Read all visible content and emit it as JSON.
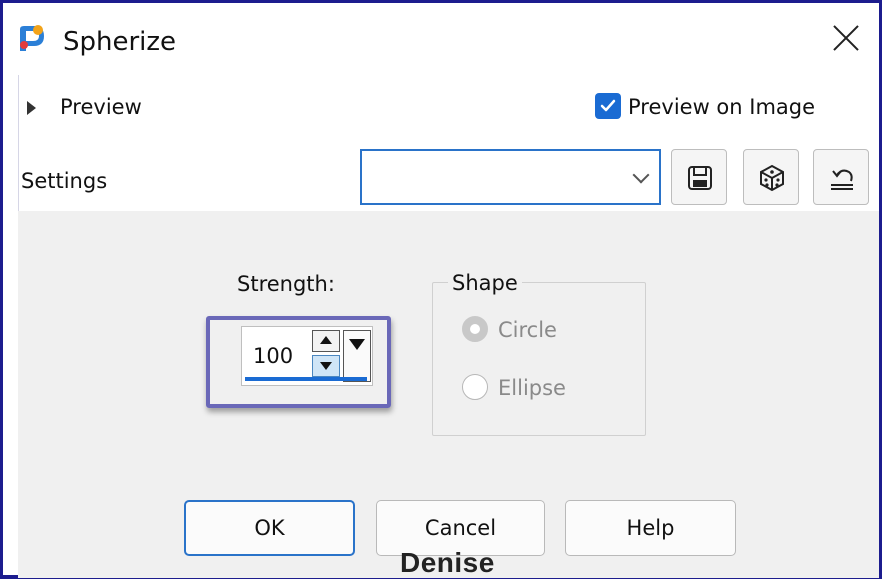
{
  "window": {
    "title": "Spherize"
  },
  "preview": {
    "label": "Preview",
    "preview_on_image_label": "Preview on Image",
    "preview_on_image_checked": true
  },
  "settings": {
    "label": "Settings",
    "value": ""
  },
  "strength": {
    "label": "Strength:",
    "value": "100"
  },
  "shape": {
    "legend": "Shape",
    "options": [
      "Circle",
      "Ellipse"
    ],
    "selected": "Circle"
  },
  "buttons": {
    "ok": "OK",
    "cancel": "Cancel",
    "help": "Help"
  },
  "watermark": "Denise",
  "colors": {
    "accent": "#1a6bd3",
    "highlight_border": "#6a68b8",
    "frame": "#1c1c8e",
    "panel": "#f0f0f0"
  }
}
